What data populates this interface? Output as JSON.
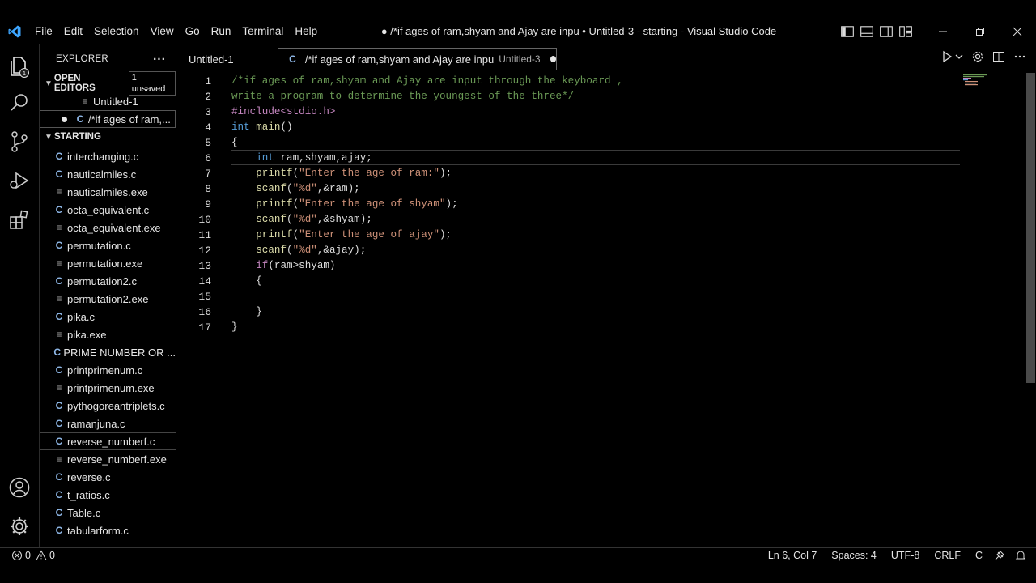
{
  "menu": [
    "File",
    "Edit",
    "Selection",
    "View",
    "Go",
    "Run",
    "Terminal",
    "Help"
  ],
  "window_title": "● /*if ages of ram,shyam and Ajay are inpu • Untitled-3 - starting - Visual Studio Code",
  "explorer": {
    "title": "EXPLORER",
    "more": "···",
    "open_editors_label": "OPEN EDITORS",
    "unsaved_badge": "1 unsaved",
    "open_editors": [
      {
        "name": "Untitled-1"
      },
      {
        "name": "/*if ages of ram,..."
      }
    ],
    "folder_label": "STARTING",
    "files": [
      {
        "name": "interchanging.c",
        "type": "c"
      },
      {
        "name": "nauticalmiles.c",
        "type": "c"
      },
      {
        "name": "nauticalmiles.exe",
        "type": "exe"
      },
      {
        "name": "octa_equivalent.c",
        "type": "c"
      },
      {
        "name": "octa_equivalent.exe",
        "type": "exe"
      },
      {
        "name": "permutation.c",
        "type": "c"
      },
      {
        "name": "permutation.exe",
        "type": "exe"
      },
      {
        "name": "permutation2.c",
        "type": "c"
      },
      {
        "name": "permutation2.exe",
        "type": "exe"
      },
      {
        "name": "pika.c",
        "type": "c"
      },
      {
        "name": "pika.exe",
        "type": "exe"
      },
      {
        "name": "PRIME NUMBER OR ...",
        "type": "c"
      },
      {
        "name": "printprimenum.c",
        "type": "c"
      },
      {
        "name": "printprimenum.exe",
        "type": "exe"
      },
      {
        "name": "pythogoreantriplets.c",
        "type": "c"
      },
      {
        "name": "ramanjuna.c",
        "type": "c"
      },
      {
        "name": "reverse_numberf.c",
        "type": "c"
      },
      {
        "name": "reverse_numberf.exe",
        "type": "exe"
      },
      {
        "name": "reverse.c",
        "type": "c"
      },
      {
        "name": "t_ratios.c",
        "type": "c"
      },
      {
        "name": "Table.c",
        "type": "c"
      },
      {
        "name": "tabularform.c",
        "type": "c"
      }
    ]
  },
  "tabs": [
    {
      "label": "Untitled-1",
      "description": ""
    },
    {
      "label": "/*if ages of ram,shyam and Ajay are inpu",
      "description": "Untitled-3"
    }
  ],
  "code_lines": [
    "/*if ages of ram,shyam and Ajay are input through the keyboard ,",
    "write a program to determine the youngest of the three*/",
    "#include<stdio.h>",
    "int main()",
    "{",
    "    int ram,shyam,ajay;",
    "    printf(\"Enter the age of ram:\");",
    "    scanf(\"%d\",&ram);",
    "    printf(\"Enter the age of shyam\");",
    "    scanf(\"%d\",&shyam);",
    "    printf(\"Enter the age of ajay\");",
    "    scanf(\"%d\",&ajay);",
    "    if(ram>shyam)",
    "    {",
    "",
    "    }",
    "}"
  ],
  "status": {
    "errors": "0",
    "warnings": "0",
    "position": "Ln 6, Col 7",
    "spaces": "Spaces: 4",
    "encoding": "UTF-8",
    "eol": "CRLF",
    "language": "C"
  },
  "colors": {
    "keyword": "#569cd6",
    "string": "#ce9178",
    "comment": "#6a9955",
    "preprocessor": "#c586c0",
    "accent": "#0078d4"
  }
}
